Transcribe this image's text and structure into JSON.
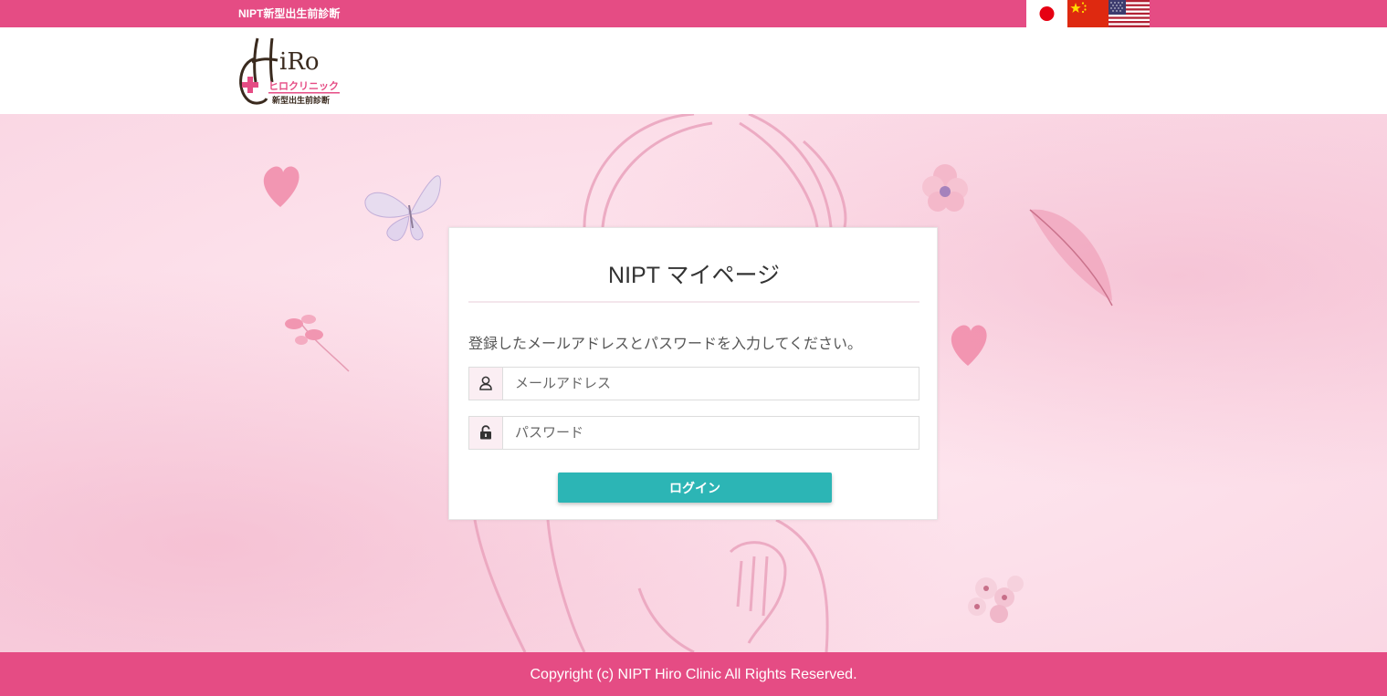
{
  "topbar": {
    "title": "NIPT新型出生前診断",
    "languages": [
      {
        "code": "ja",
        "icon": "japan-flag-icon"
      },
      {
        "code": "zh",
        "icon": "china-flag-icon"
      },
      {
        "code": "en",
        "icon": "usa-flag-icon"
      }
    ]
  },
  "header": {
    "logo": {
      "wordmark": "HiRo",
      "katakana": "ヒロクリニック",
      "subtitle": "新型出生前診断"
    }
  },
  "login": {
    "title": "NIPT マイページ",
    "instruction": "登録したメールアドレスとパスワードを入力してください。",
    "email": {
      "placeholder": "メールアドレス",
      "value": "",
      "icon": "user-icon"
    },
    "password": {
      "placeholder": "パスワード",
      "value": "",
      "icon": "lock-icon"
    },
    "button_label": "ログイン"
  },
  "footer": {
    "copyright": "Copyright (c) NIPT Hiro Clinic All Rights Reserved."
  },
  "colors": {
    "brand_pink": "#e54c84",
    "button_teal": "#2cb5b5",
    "background_pink": "#f9dce6"
  }
}
